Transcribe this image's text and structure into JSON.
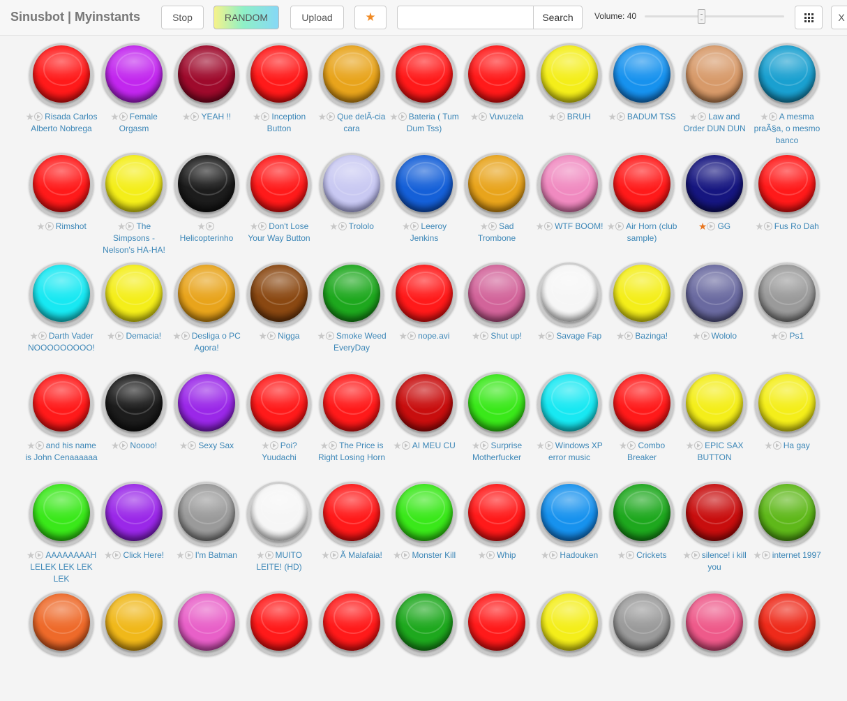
{
  "header": {
    "title": "Sinusbot | Myinstants",
    "stop_label": "Stop",
    "random_label": "RANDOM",
    "upload_label": "Upload",
    "favorites_icon": "★",
    "search": {
      "value": "",
      "placeholder": ""
    },
    "search_label": "Search",
    "volume_label": "Volume: 40",
    "volume_value": 40,
    "grid_icon": "grid-icon",
    "close_label": "X"
  },
  "colors": {
    "red": [
      "#ff1a1a",
      "#8a0000"
    ],
    "purple": [
      "#c227ee",
      "#5e0a7e"
    ],
    "maroon": [
      "#9e0a2c",
      "#42000e"
    ],
    "orange": [
      "#e8a41c",
      "#7a4d00"
    ],
    "yellow": [
      "#f4ee1a",
      "#868000"
    ],
    "blue": [
      "#1792ee",
      "#053a78"
    ],
    "tan": [
      "#d79a6a",
      "#6e4320"
    ],
    "teal": [
      "#1aa0d0",
      "#05465e"
    ],
    "black": [
      "#1c1c1c",
      "#000000"
    ],
    "lavender": [
      "#c9c9f2",
      "#6a6aa4"
    ],
    "royal": [
      "#1560d8",
      "#062a6e"
    ],
    "pink": [
      "#f08ac0",
      "#8a3d66"
    ],
    "navy": [
      "#161680",
      "#05052e"
    ],
    "cyan": [
      "#18e8f2",
      "#067a80"
    ],
    "brown": [
      "#8a4812",
      "#3a1800"
    ],
    "green": [
      "#1ea81e",
      "#064a06"
    ],
    "mauve": [
      "#d2649a",
      "#6a2448"
    ],
    "white": [
      "#f6f6f6",
      "#9a9a9a"
    ],
    "slate": [
      "#6a6aa0",
      "#2a2a4a"
    ],
    "gray": [
      "#9a9a9a",
      "#3e3e3e"
    ],
    "darkred": [
      "#c80e0e",
      "#5a0000"
    ],
    "lime": [
      "#3ae81a",
      "#127400"
    ],
    "olive": [
      "#5fb81a",
      "#245a00"
    ],
    "violet": [
      "#9a28e8",
      "#42086e"
    ],
    "gold": [
      "#f0b81a",
      "#7a5200"
    ],
    "hotpink": [
      "#e860c8",
      "#7a2268"
    ],
    "coral": [
      "#ee6a2a",
      "#7a2a08"
    ],
    "rose": [
      "#ee5a8a",
      "#7a1e40"
    ],
    "scarlet": [
      "#ee2a1a",
      "#7a0e00"
    ],
    "star_on": "#e8761f",
    "link": "#3d87b7"
  },
  "buttons": [
    {
      "label": "Risada Carlos Alberto Nobrega",
      "color": "red",
      "fav": false
    },
    {
      "label": "Female Orgasm",
      "color": "purple",
      "fav": false
    },
    {
      "label": "YEAH !!",
      "color": "maroon",
      "fav": false
    },
    {
      "label": "Inception Button",
      "color": "red",
      "fav": false
    },
    {
      "label": "Que delÃ-cia cara",
      "color": "orange",
      "fav": false
    },
    {
      "label": "Bateria ( Tum Dum Tss)",
      "color": "red",
      "fav": false
    },
    {
      "label": "Vuvuzela",
      "color": "red",
      "fav": false
    },
    {
      "label": "BRUH",
      "color": "yellow",
      "fav": false
    },
    {
      "label": "BADUM TSS",
      "color": "blue",
      "fav": false
    },
    {
      "label": "Law and Order DUN DUN",
      "color": "tan",
      "fav": false
    },
    {
      "label": "A mesma praÃ§a, o mesmo banco",
      "color": "teal",
      "fav": false
    },
    {
      "label": "Rimshot",
      "color": "red",
      "fav": false
    },
    {
      "label": "The Simpsons - Nelson's HA-HA!",
      "color": "yellow",
      "fav": false
    },
    {
      "label": "Helicopterinho",
      "color": "black",
      "fav": false
    },
    {
      "label": "Don't Lose Your Way Button",
      "color": "red",
      "fav": false
    },
    {
      "label": "Trololo",
      "color": "lavender",
      "fav": false
    },
    {
      "label": "Leeroy Jenkins",
      "color": "royal",
      "fav": false
    },
    {
      "label": "Sad Trombone",
      "color": "orange",
      "fav": false
    },
    {
      "label": "WTF BOOM!",
      "color": "pink",
      "fav": false
    },
    {
      "label": "Air Horn (club sample)",
      "color": "red",
      "fav": false
    },
    {
      "label": "GG",
      "color": "navy",
      "fav": true
    },
    {
      "label": "Fus Ro Dah",
      "color": "red",
      "fav": false
    },
    {
      "label": "Darth Vader NOOOOOOOOO!",
      "color": "cyan",
      "fav": false
    },
    {
      "label": "Demacia!",
      "color": "yellow",
      "fav": false
    },
    {
      "label": "Desliga o PC Agora!",
      "color": "orange",
      "fav": false
    },
    {
      "label": "Nigga",
      "color": "brown",
      "fav": false
    },
    {
      "label": "Smoke Weed EveryDay",
      "color": "green",
      "fav": false
    },
    {
      "label": "nope.avi",
      "color": "red",
      "fav": false
    },
    {
      "label": "Shut up!",
      "color": "mauve",
      "fav": false
    },
    {
      "label": "Savage Fap",
      "color": "white",
      "fav": false
    },
    {
      "label": "Bazinga!",
      "color": "yellow",
      "fav": false
    },
    {
      "label": "Wololo",
      "color": "slate",
      "fav": false
    },
    {
      "label": "Ps1",
      "color": "gray",
      "fav": false
    },
    {
      "label": "and his name is John Cenaaaaaa",
      "color": "red",
      "fav": false
    },
    {
      "label": "Noooo!",
      "color": "black",
      "fav": false
    },
    {
      "label": "Sexy Sax",
      "color": "violet",
      "fav": false
    },
    {
      "label": "Poi? Yuudachi",
      "color": "red",
      "fav": false
    },
    {
      "label": "The Price is Right Losing Horn",
      "color": "red",
      "fav": false
    },
    {
      "label": "AI MEU CU",
      "color": "darkred",
      "fav": false
    },
    {
      "label": "Surprise Motherfucker",
      "color": "lime",
      "fav": false
    },
    {
      "label": "Windows XP error music",
      "color": "cyan",
      "fav": false
    },
    {
      "label": "Combo Breaker",
      "color": "red",
      "fav": false
    },
    {
      "label": "EPIC SAX BUTTON",
      "color": "yellow",
      "fav": false
    },
    {
      "label": "Ha gay",
      "color": "yellow",
      "fav": false
    },
    {
      "label": "AAAAAAAAH LELEK LEK LEK LEK",
      "color": "lime",
      "fav": false
    },
    {
      "label": "Click Here!",
      "color": "violet",
      "fav": false
    },
    {
      "label": "I'm Batman",
      "color": "gray",
      "fav": false
    },
    {
      "label": "MUITO LEITE! (HD)",
      "color": "white",
      "fav": false
    },
    {
      "label": "Ã Malafaia!",
      "color": "red",
      "fav": false
    },
    {
      "label": "Monster Kill",
      "color": "lime",
      "fav": false
    },
    {
      "label": "Whip",
      "color": "red",
      "fav": false
    },
    {
      "label": "Hadouken",
      "color": "blue",
      "fav": false
    },
    {
      "label": "Crickets",
      "color": "green",
      "fav": false
    },
    {
      "label": "silence! i kill you",
      "color": "darkred",
      "fav": false
    },
    {
      "label": "internet 1997",
      "color": "olive",
      "fav": false
    },
    {
      "label": "",
      "color": "coral",
      "fav": false
    },
    {
      "label": "",
      "color": "gold",
      "fav": false
    },
    {
      "label": "",
      "color": "hotpink",
      "fav": false
    },
    {
      "label": "",
      "color": "red",
      "fav": false
    },
    {
      "label": "",
      "color": "red",
      "fav": false
    },
    {
      "label": "",
      "color": "green",
      "fav": false
    },
    {
      "label": "",
      "color": "red",
      "fav": false
    },
    {
      "label": "",
      "color": "yellow",
      "fav": false
    },
    {
      "label": "",
      "color": "gray",
      "fav": false
    },
    {
      "label": "",
      "color": "rose",
      "fav": false
    },
    {
      "label": "",
      "color": "scarlet",
      "fav": false
    }
  ]
}
